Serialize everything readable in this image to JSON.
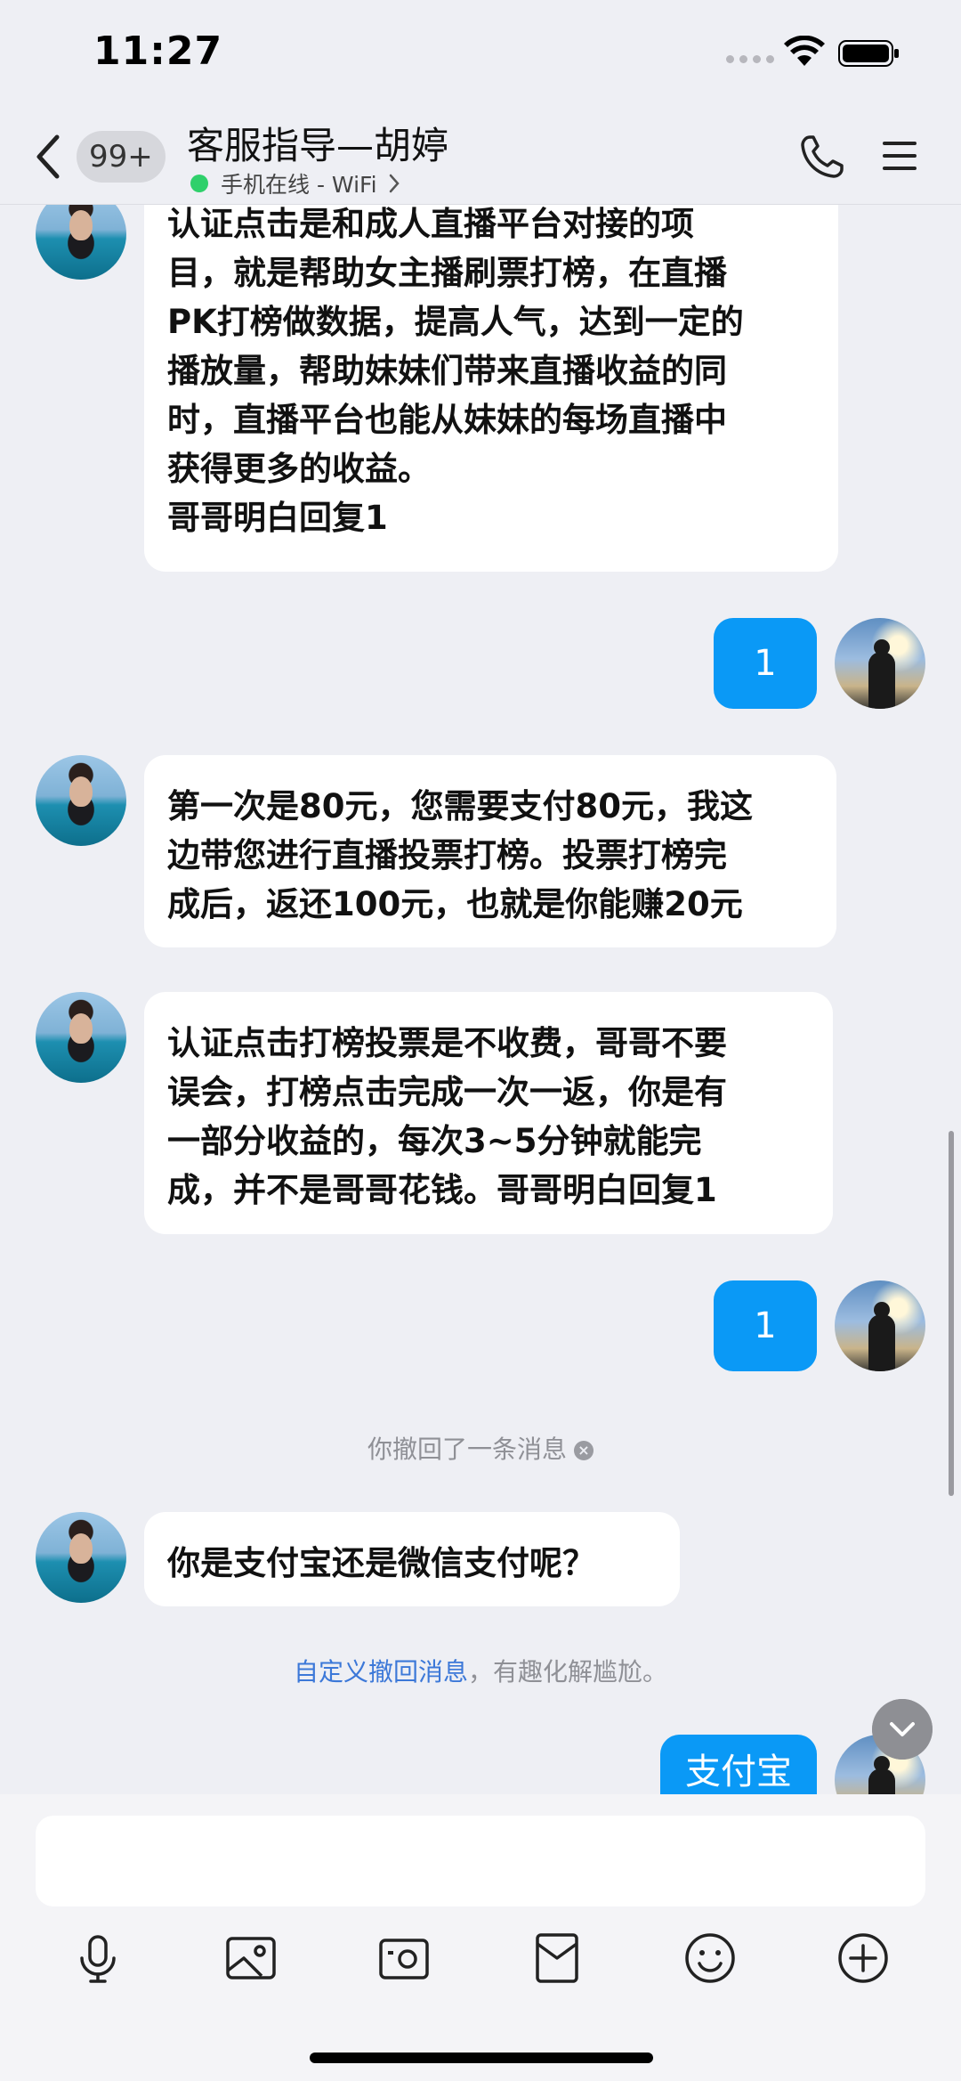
{
  "status_bar": {
    "time": "11:27"
  },
  "header": {
    "unread_count": "99+",
    "contact_name": "客服指导—胡婷",
    "online_status": "手机在线 - WiFi",
    "colors": {
      "online_dot": "#2fd06b"
    }
  },
  "messages": [
    {
      "sender": "contact",
      "text": "认证点击是和成人直播平台对接的项\n目，就是帮助女主播刷票打榜，在直播\nPK打榜做数据，提高人气，达到一定的\n播放量，帮助妹妹们带来直播收益的同\n时，直播平台也能从妹妹的每场直播中\n获得更多的收益。\n哥哥明白回复1"
    },
    {
      "sender": "me",
      "text": "1"
    },
    {
      "sender": "contact",
      "text": "第一次是80元，您需要支付80元，我这\n边带您进行直播投票打榜。投票打榜完\n成后，返还100元，也就是你能赚20元"
    },
    {
      "sender": "contact",
      "text": "认证点击打榜投票是不收费，哥哥不要\n误会，打榜点击完成一次一返，你是有\n一部分收益的，每次3~5分钟就能完\n成，并不是哥哥花钱。哥哥明白回复1"
    },
    {
      "sender": "me",
      "text": "1"
    },
    {
      "sender": "system",
      "text": "你撤回了一条消息"
    },
    {
      "sender": "contact",
      "text": "你是支付宝还是微信支付呢？"
    },
    {
      "sender": "system_tip",
      "link": "自定义撤回消息",
      "text": "，有趣化解尴尬。"
    },
    {
      "sender": "me",
      "text": "支付宝"
    }
  ],
  "input": {
    "placeholder": ""
  },
  "toolbar": [
    "microphone-icon",
    "image-icon",
    "camera-icon",
    "red-packet-icon",
    "emoji-icon",
    "plus-icon"
  ],
  "colors": {
    "outgoing_bubble": "#0a99f6",
    "background": "#eeeff4"
  }
}
